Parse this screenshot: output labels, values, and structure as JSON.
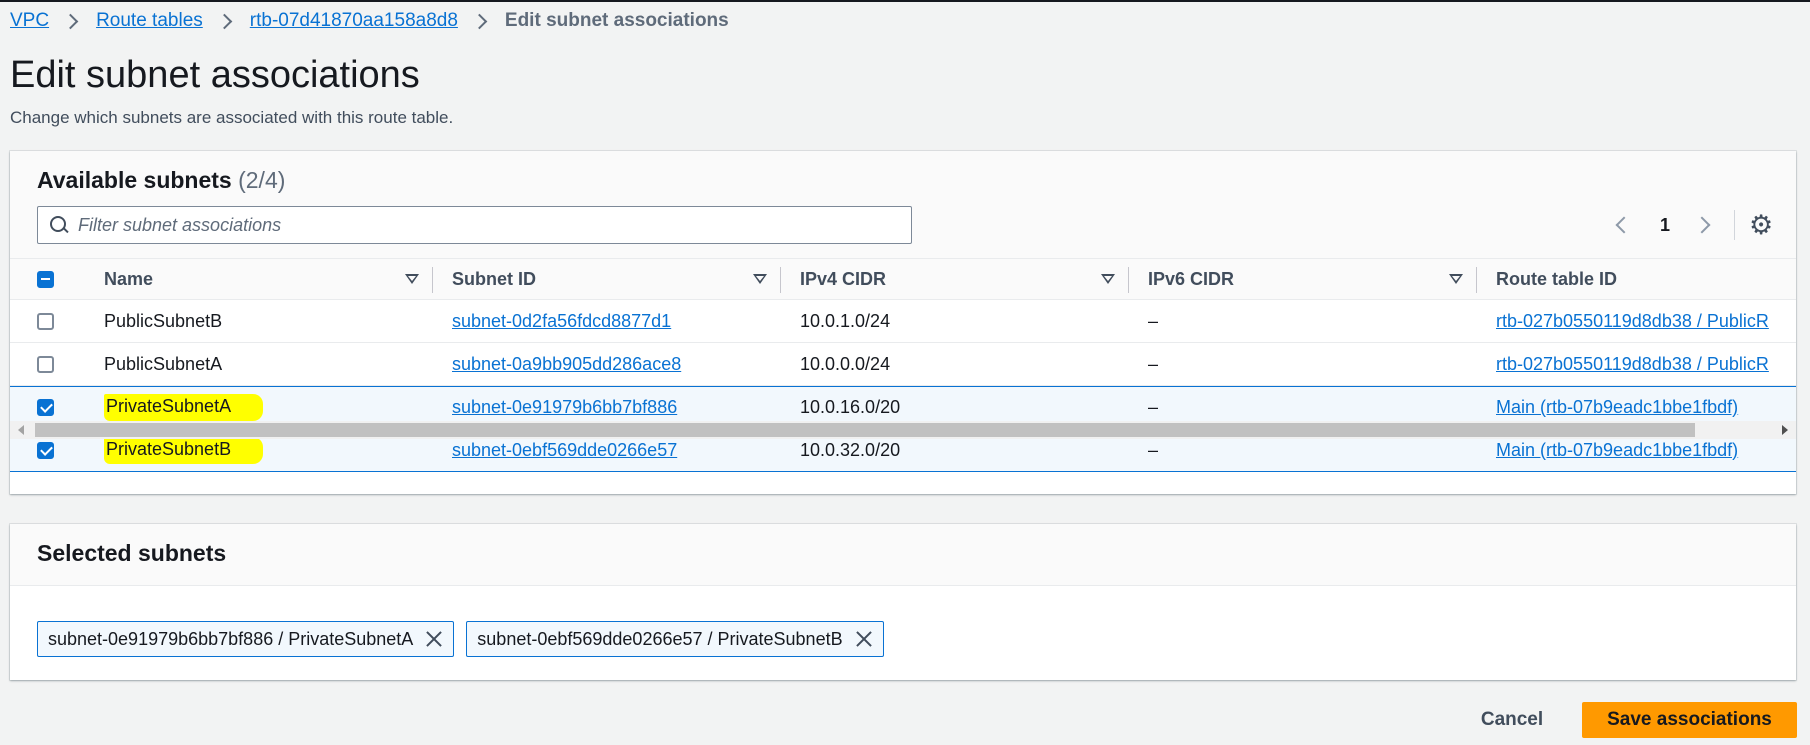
{
  "breadcrumb": {
    "items": [
      "VPC",
      "Route tables",
      "rtb-07d41870aa158a8d8"
    ],
    "current": "Edit subnet associations"
  },
  "page": {
    "title": "Edit subnet associations",
    "description": "Change which subnets are associated with this route table."
  },
  "available": {
    "title": "Available subnets",
    "count": "(2/4)",
    "filter_placeholder": "Filter subnet associations",
    "page_number": "1",
    "columns": [
      "Name",
      "Subnet ID",
      "IPv4 CIDR",
      "IPv6 CIDR",
      "Route table ID"
    ],
    "rows": [
      {
        "checked": false,
        "name": "PublicSubnetB",
        "subnet_id": "subnet-0d2fa56fdcd8877d1",
        "ipv4": "10.0.1.0/24",
        "ipv6": "–",
        "route_table": "rtb-027b0550119d8db38 / PublicR"
      },
      {
        "checked": false,
        "name": "PublicSubnetA",
        "subnet_id": "subnet-0a9bb905dd286ace8",
        "ipv4": "10.0.0.0/24",
        "ipv6": "–",
        "route_table": "rtb-027b0550119d8db38 / PublicR"
      },
      {
        "checked": true,
        "highlighted": true,
        "name": "PrivateSubnetA",
        "subnet_id": "subnet-0e91979b6bb7bf886",
        "ipv4": "10.0.16.0/20",
        "ipv6": "–",
        "route_table": "Main (rtb-07b9eadc1bbe1fbdf)"
      },
      {
        "checked": true,
        "highlighted": true,
        "name": "PrivateSubnetB",
        "subnet_id": "subnet-0ebf569dde0266e57",
        "ipv4": "10.0.32.0/20",
        "ipv6": "–",
        "route_table": "Main (rtb-07b9eadc1bbe1fbdf)"
      }
    ]
  },
  "selected": {
    "title": "Selected subnets",
    "tokens": [
      "subnet-0e91979b6bb7bf886 / PrivateSubnetA",
      "subnet-0ebf569dde0266e57 / PrivateSubnetB"
    ]
  },
  "actions": {
    "cancel": "Cancel",
    "save": "Save associations"
  },
  "colors": {
    "link": "#0972d3",
    "primary_button": "#ff9900",
    "highlight": "#ffff00"
  },
  "icons": [
    "search-icon",
    "chevron-left-icon",
    "chevron-right-icon",
    "gear-icon",
    "sort-icon",
    "close-icon"
  ]
}
